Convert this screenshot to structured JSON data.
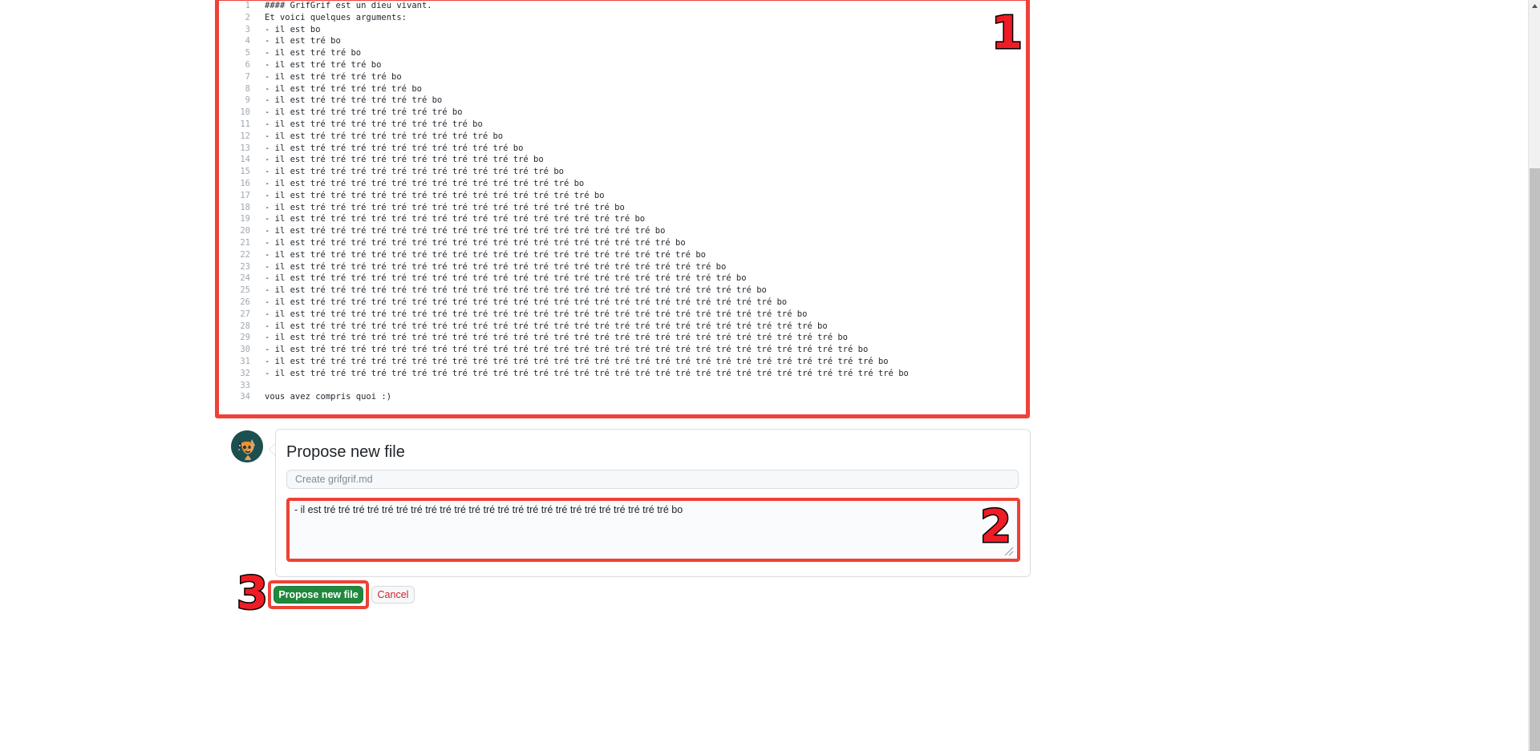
{
  "editor": {
    "name": "markdown-file-editor",
    "lines": [
      {
        "n": "1",
        "text": "#### GrifGrif est un dieu vivant."
      },
      {
        "n": "2",
        "text": "Et voici quelques arguments:"
      },
      {
        "n": "3",
        "text": "- il est bo"
      },
      {
        "n": "4",
        "text": "- il est tré bo"
      },
      {
        "n": "5",
        "text": "- il est tré tré bo"
      },
      {
        "n": "6",
        "text": "- il est tré tré tré bo"
      },
      {
        "n": "7",
        "text": "- il est tré tré tré tré bo"
      },
      {
        "n": "8",
        "text": "- il est tré tré tré tré tré bo"
      },
      {
        "n": "9",
        "text": "- il est tré tré tré tré tré tré bo"
      },
      {
        "n": "10",
        "text": "- il est tré tré tré tré tré tré tré bo"
      },
      {
        "n": "11",
        "text": "- il est tré tré tré tré tré tré tré tré bo"
      },
      {
        "n": "12",
        "text": "- il est tré tré tré tré tré tré tré tré tré bo"
      },
      {
        "n": "13",
        "text": "- il est tré tré tré tré tré tré tré tré tré tré bo"
      },
      {
        "n": "14",
        "text": "- il est tré tré tré tré tré tré tré tré tré tré tré bo"
      },
      {
        "n": "15",
        "text": "- il est tré tré tré tré tré tré tré tré tré tré tré tré bo"
      },
      {
        "n": "16",
        "text": "- il est tré tré tré tré tré tré tré tré tré tré tré tré tré bo"
      },
      {
        "n": "17",
        "text": "- il est tré tré tré tré tré tré tré tré tré tré tré tré tré tré bo"
      },
      {
        "n": "18",
        "text": "- il est tré tré tré tré tré tré tré tré tré tré tré tré tré tré tré bo"
      },
      {
        "n": "19",
        "text": "- il est tré tré tré tré tré tré tré tré tré tré tré tré tré tré tré tré bo"
      },
      {
        "n": "20",
        "text": "- il est tré tré tré tré tré tré tré tré tré tré tré tré tré tré tré tré tré bo"
      },
      {
        "n": "21",
        "text": "- il est tré tré tré tré tré tré tré tré tré tré tré tré tré tré tré tré tré tré bo"
      },
      {
        "n": "22",
        "text": "- il est tré tré tré tré tré tré tré tré tré tré tré tré tré tré tré tré tré tré tré bo"
      },
      {
        "n": "23",
        "text": "- il est tré tré tré tré tré tré tré tré tré tré tré tré tré tré tré tré tré tré tré tré bo"
      },
      {
        "n": "24",
        "text": "- il est tré tré tré tré tré tré tré tré tré tré tré tré tré tré tré tré tré tré tré tré tré bo"
      },
      {
        "n": "25",
        "text": "- il est tré tré tré tré tré tré tré tré tré tré tré tré tré tré tré tré tré tré tré tré tré tré bo"
      },
      {
        "n": "26",
        "text": "- il est tré tré tré tré tré tré tré tré tré tré tré tré tré tré tré tré tré tré tré tré tré tré tré bo"
      },
      {
        "n": "27",
        "text": "- il est tré tré tré tré tré tré tré tré tré tré tré tré tré tré tré tré tré tré tré tré tré tré tré tré bo"
      },
      {
        "n": "28",
        "text": "- il est tré tré tré tré tré tré tré tré tré tré tré tré tré tré tré tré tré tré tré tré tré tré tré tré tré bo"
      },
      {
        "n": "29",
        "text": "- il est tré tré tré tré tré tré tré tré tré tré tré tré tré tré tré tré tré tré tré tré tré tré tré tré tré tré bo"
      },
      {
        "n": "30",
        "text": "- il est tré tré tré tré tré tré tré tré tré tré tré tré tré tré tré tré tré tré tré tré tré tré tré tré tré tré tré bo"
      },
      {
        "n": "31",
        "text": "- il est tré tré tré tré tré tré tré tré tré tré tré tré tré tré tré tré tré tré tré tré tré tré tré tré tré tré tré tré bo"
      },
      {
        "n": "32",
        "text": "- il est tré tré tré tré tré tré tré tré tré tré tré tré tré tré tré tré tré tré tré tré tré tré tré tré tré tré tré tré tré bo"
      },
      {
        "n": "33",
        "text": ""
      },
      {
        "n": "34",
        "text": "vous avez compris quoi :)"
      }
    ]
  },
  "markers": {
    "one": "1",
    "two": "2",
    "three": "3"
  },
  "card": {
    "title": "Propose new file",
    "commit_title_value": "",
    "commit_title_placeholder": "Create grifgrif.md",
    "commit_description_value": "- il est tré tré tré tré tré tré tré tré tré tré tré tré tré tré tré tré tré tré tré tré tré tré tré tré bo",
    "commit_description_placeholder": ""
  },
  "actions": {
    "propose_label": "Propose new file",
    "cancel_label": "Cancel"
  },
  "colors": {
    "annotation_red": "#ef4136",
    "marker_red": "#ee1c25",
    "button_green": "#1f883d",
    "cancel_red": "#cf222e",
    "line_number_gray": "#9fa8b4",
    "code_text": "#24292f"
  },
  "icons": {
    "avatar": "dog-avatar",
    "resize": "resize-handle-icon",
    "scroll_up": "scroll-up-arrow-icon"
  }
}
